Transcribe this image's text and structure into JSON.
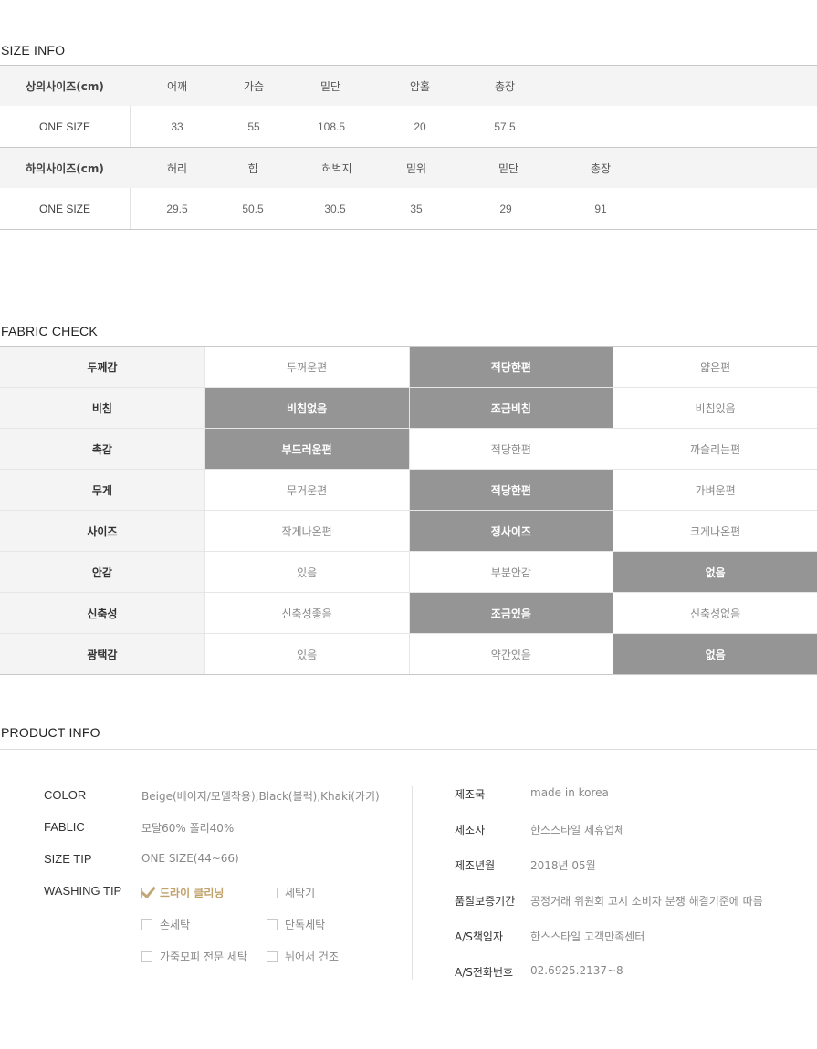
{
  "size_info": {
    "title": "SIZE INFO",
    "top": {
      "label": "상의사이즈(cm)",
      "columns": [
        "어깨",
        "가슴",
        "밑단",
        "암홀",
        "총장"
      ],
      "row_label": "ONE SIZE",
      "values": [
        "33",
        "55",
        "108.5",
        "20",
        "57.5"
      ]
    },
    "bottom": {
      "label": "하의사이즈(cm)",
      "columns": [
        "허리",
        "힙",
        "허벅지",
        "밑위",
        "밑단",
        "총장"
      ],
      "row_label": "ONE SIZE",
      "values": [
        "29.5",
        "50.5",
        "30.5",
        "35",
        "29",
        "91"
      ]
    }
  },
  "fabric_check": {
    "title": "FABRIC CHECK",
    "rows": [
      {
        "name": "두께감",
        "options": [
          "두꺼운편",
          "적당한편",
          "얇은편"
        ],
        "selected": [
          false,
          true,
          false
        ]
      },
      {
        "name": "비침",
        "options": [
          "비침없음",
          "조금비침",
          "비침있음"
        ],
        "selected": [
          true,
          true,
          false
        ]
      },
      {
        "name": "촉감",
        "options": [
          "부드러운편",
          "적당한편",
          "까슬리는편"
        ],
        "selected": [
          true,
          false,
          false
        ]
      },
      {
        "name": "무게",
        "options": [
          "무거운편",
          "적당한편",
          "가벼운편"
        ],
        "selected": [
          false,
          true,
          false
        ]
      },
      {
        "name": "사이즈",
        "options": [
          "작게나온편",
          "정사이즈",
          "크게나온편"
        ],
        "selected": [
          false,
          true,
          false
        ]
      },
      {
        "name": "안감",
        "options": [
          "있음",
          "부분안감",
          "없음"
        ],
        "selected": [
          false,
          false,
          true
        ]
      },
      {
        "name": "신축성",
        "options": [
          "신축성좋음",
          "조금있음",
          "신축성없음"
        ],
        "selected": [
          false,
          true,
          false
        ]
      },
      {
        "name": "광택감",
        "options": [
          "있음",
          "약간있음",
          "없음"
        ],
        "selected": [
          false,
          false,
          true
        ]
      }
    ]
  },
  "product_info": {
    "title": "PRODUCT INFO",
    "color_label": "COLOR",
    "color_value": "Beige(베이지/모델착용),Black(블랙),Khaki(카키)",
    "fabric_label": "FABLIC",
    "fabric_value": "모달60% 폴리40%",
    "size_tip_label": "SIZE TIP",
    "size_tip_value": "ONE SIZE(44~66)",
    "washing_label": "WASHING TIP",
    "washing_options": [
      {
        "label": "드라이 클리닝",
        "checked": true
      },
      {
        "label": "세탁기",
        "checked": false
      },
      {
        "label": "손세탁",
        "checked": false
      },
      {
        "label": "단독세탁",
        "checked": false
      },
      {
        "label": "가죽모피 전문 세탁",
        "checked": false
      },
      {
        "label": "뉘어서 건조",
        "checked": false
      }
    ],
    "details": [
      {
        "label": "제조국",
        "value": "made in korea"
      },
      {
        "label": "제조자",
        "value": "한스스타일 제휴업체"
      },
      {
        "label": "제조년월",
        "value": "2018년 05월"
      },
      {
        "label": "품질보증기간",
        "value": "공정거래 위원회 고시 소비자 분쟁 해결기준에 따름"
      },
      {
        "label": "A/S책임자",
        "value": "한스스타일 고객만족센터"
      },
      {
        "label": "A/S전화번호",
        "value": "02.6925.2137~8"
      }
    ]
  },
  "colors": {
    "selected_cell": "#959595",
    "label_bg": "#f4f4f4",
    "wash_checked": "#c2a26b"
  }
}
